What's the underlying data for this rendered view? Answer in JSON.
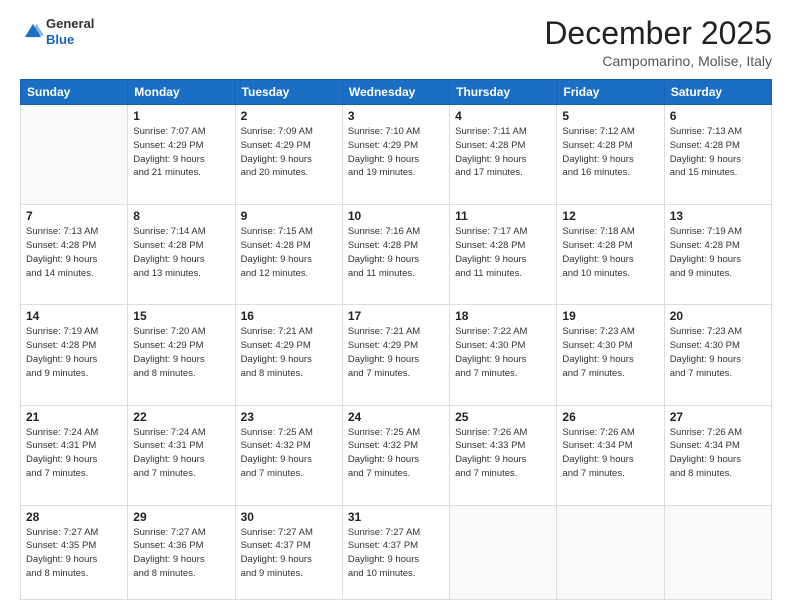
{
  "header": {
    "logo_line1": "General",
    "logo_line2": "Blue",
    "month": "December 2025",
    "location": "Campomarino, Molise, Italy"
  },
  "weekdays": [
    "Sunday",
    "Monday",
    "Tuesday",
    "Wednesday",
    "Thursday",
    "Friday",
    "Saturday"
  ],
  "weeks": [
    [
      {
        "day": "",
        "info": ""
      },
      {
        "day": "1",
        "info": "Sunrise: 7:07 AM\nSunset: 4:29 PM\nDaylight: 9 hours\nand 21 minutes."
      },
      {
        "day": "2",
        "info": "Sunrise: 7:09 AM\nSunset: 4:29 PM\nDaylight: 9 hours\nand 20 minutes."
      },
      {
        "day": "3",
        "info": "Sunrise: 7:10 AM\nSunset: 4:29 PM\nDaylight: 9 hours\nand 19 minutes."
      },
      {
        "day": "4",
        "info": "Sunrise: 7:11 AM\nSunset: 4:28 PM\nDaylight: 9 hours\nand 17 minutes."
      },
      {
        "day": "5",
        "info": "Sunrise: 7:12 AM\nSunset: 4:28 PM\nDaylight: 9 hours\nand 16 minutes."
      },
      {
        "day": "6",
        "info": "Sunrise: 7:13 AM\nSunset: 4:28 PM\nDaylight: 9 hours\nand 15 minutes."
      }
    ],
    [
      {
        "day": "7",
        "info": "Sunrise: 7:13 AM\nSunset: 4:28 PM\nDaylight: 9 hours\nand 14 minutes."
      },
      {
        "day": "8",
        "info": "Sunrise: 7:14 AM\nSunset: 4:28 PM\nDaylight: 9 hours\nand 13 minutes."
      },
      {
        "day": "9",
        "info": "Sunrise: 7:15 AM\nSunset: 4:28 PM\nDaylight: 9 hours\nand 12 minutes."
      },
      {
        "day": "10",
        "info": "Sunrise: 7:16 AM\nSunset: 4:28 PM\nDaylight: 9 hours\nand 11 minutes."
      },
      {
        "day": "11",
        "info": "Sunrise: 7:17 AM\nSunset: 4:28 PM\nDaylight: 9 hours\nand 11 minutes."
      },
      {
        "day": "12",
        "info": "Sunrise: 7:18 AM\nSunset: 4:28 PM\nDaylight: 9 hours\nand 10 minutes."
      },
      {
        "day": "13",
        "info": "Sunrise: 7:19 AM\nSunset: 4:28 PM\nDaylight: 9 hours\nand 9 minutes."
      }
    ],
    [
      {
        "day": "14",
        "info": "Sunrise: 7:19 AM\nSunset: 4:28 PM\nDaylight: 9 hours\nand 9 minutes."
      },
      {
        "day": "15",
        "info": "Sunrise: 7:20 AM\nSunset: 4:29 PM\nDaylight: 9 hours\nand 8 minutes."
      },
      {
        "day": "16",
        "info": "Sunrise: 7:21 AM\nSunset: 4:29 PM\nDaylight: 9 hours\nand 8 minutes."
      },
      {
        "day": "17",
        "info": "Sunrise: 7:21 AM\nSunset: 4:29 PM\nDaylight: 9 hours\nand 7 minutes."
      },
      {
        "day": "18",
        "info": "Sunrise: 7:22 AM\nSunset: 4:30 PM\nDaylight: 9 hours\nand 7 minutes."
      },
      {
        "day": "19",
        "info": "Sunrise: 7:23 AM\nSunset: 4:30 PM\nDaylight: 9 hours\nand 7 minutes."
      },
      {
        "day": "20",
        "info": "Sunrise: 7:23 AM\nSunset: 4:30 PM\nDaylight: 9 hours\nand 7 minutes."
      }
    ],
    [
      {
        "day": "21",
        "info": "Sunrise: 7:24 AM\nSunset: 4:31 PM\nDaylight: 9 hours\nand 7 minutes."
      },
      {
        "day": "22",
        "info": "Sunrise: 7:24 AM\nSunset: 4:31 PM\nDaylight: 9 hours\nand 7 minutes."
      },
      {
        "day": "23",
        "info": "Sunrise: 7:25 AM\nSunset: 4:32 PM\nDaylight: 9 hours\nand 7 minutes."
      },
      {
        "day": "24",
        "info": "Sunrise: 7:25 AM\nSunset: 4:32 PM\nDaylight: 9 hours\nand 7 minutes."
      },
      {
        "day": "25",
        "info": "Sunrise: 7:26 AM\nSunset: 4:33 PM\nDaylight: 9 hours\nand 7 minutes."
      },
      {
        "day": "26",
        "info": "Sunrise: 7:26 AM\nSunset: 4:34 PM\nDaylight: 9 hours\nand 7 minutes."
      },
      {
        "day": "27",
        "info": "Sunrise: 7:26 AM\nSunset: 4:34 PM\nDaylight: 9 hours\nand 8 minutes."
      }
    ],
    [
      {
        "day": "28",
        "info": "Sunrise: 7:27 AM\nSunset: 4:35 PM\nDaylight: 9 hours\nand 8 minutes."
      },
      {
        "day": "29",
        "info": "Sunrise: 7:27 AM\nSunset: 4:36 PM\nDaylight: 9 hours\nand 8 minutes."
      },
      {
        "day": "30",
        "info": "Sunrise: 7:27 AM\nSunset: 4:37 PM\nDaylight: 9 hours\nand 9 minutes."
      },
      {
        "day": "31",
        "info": "Sunrise: 7:27 AM\nSunset: 4:37 PM\nDaylight: 9 hours\nand 10 minutes."
      },
      {
        "day": "",
        "info": ""
      },
      {
        "day": "",
        "info": ""
      },
      {
        "day": "",
        "info": ""
      }
    ]
  ]
}
